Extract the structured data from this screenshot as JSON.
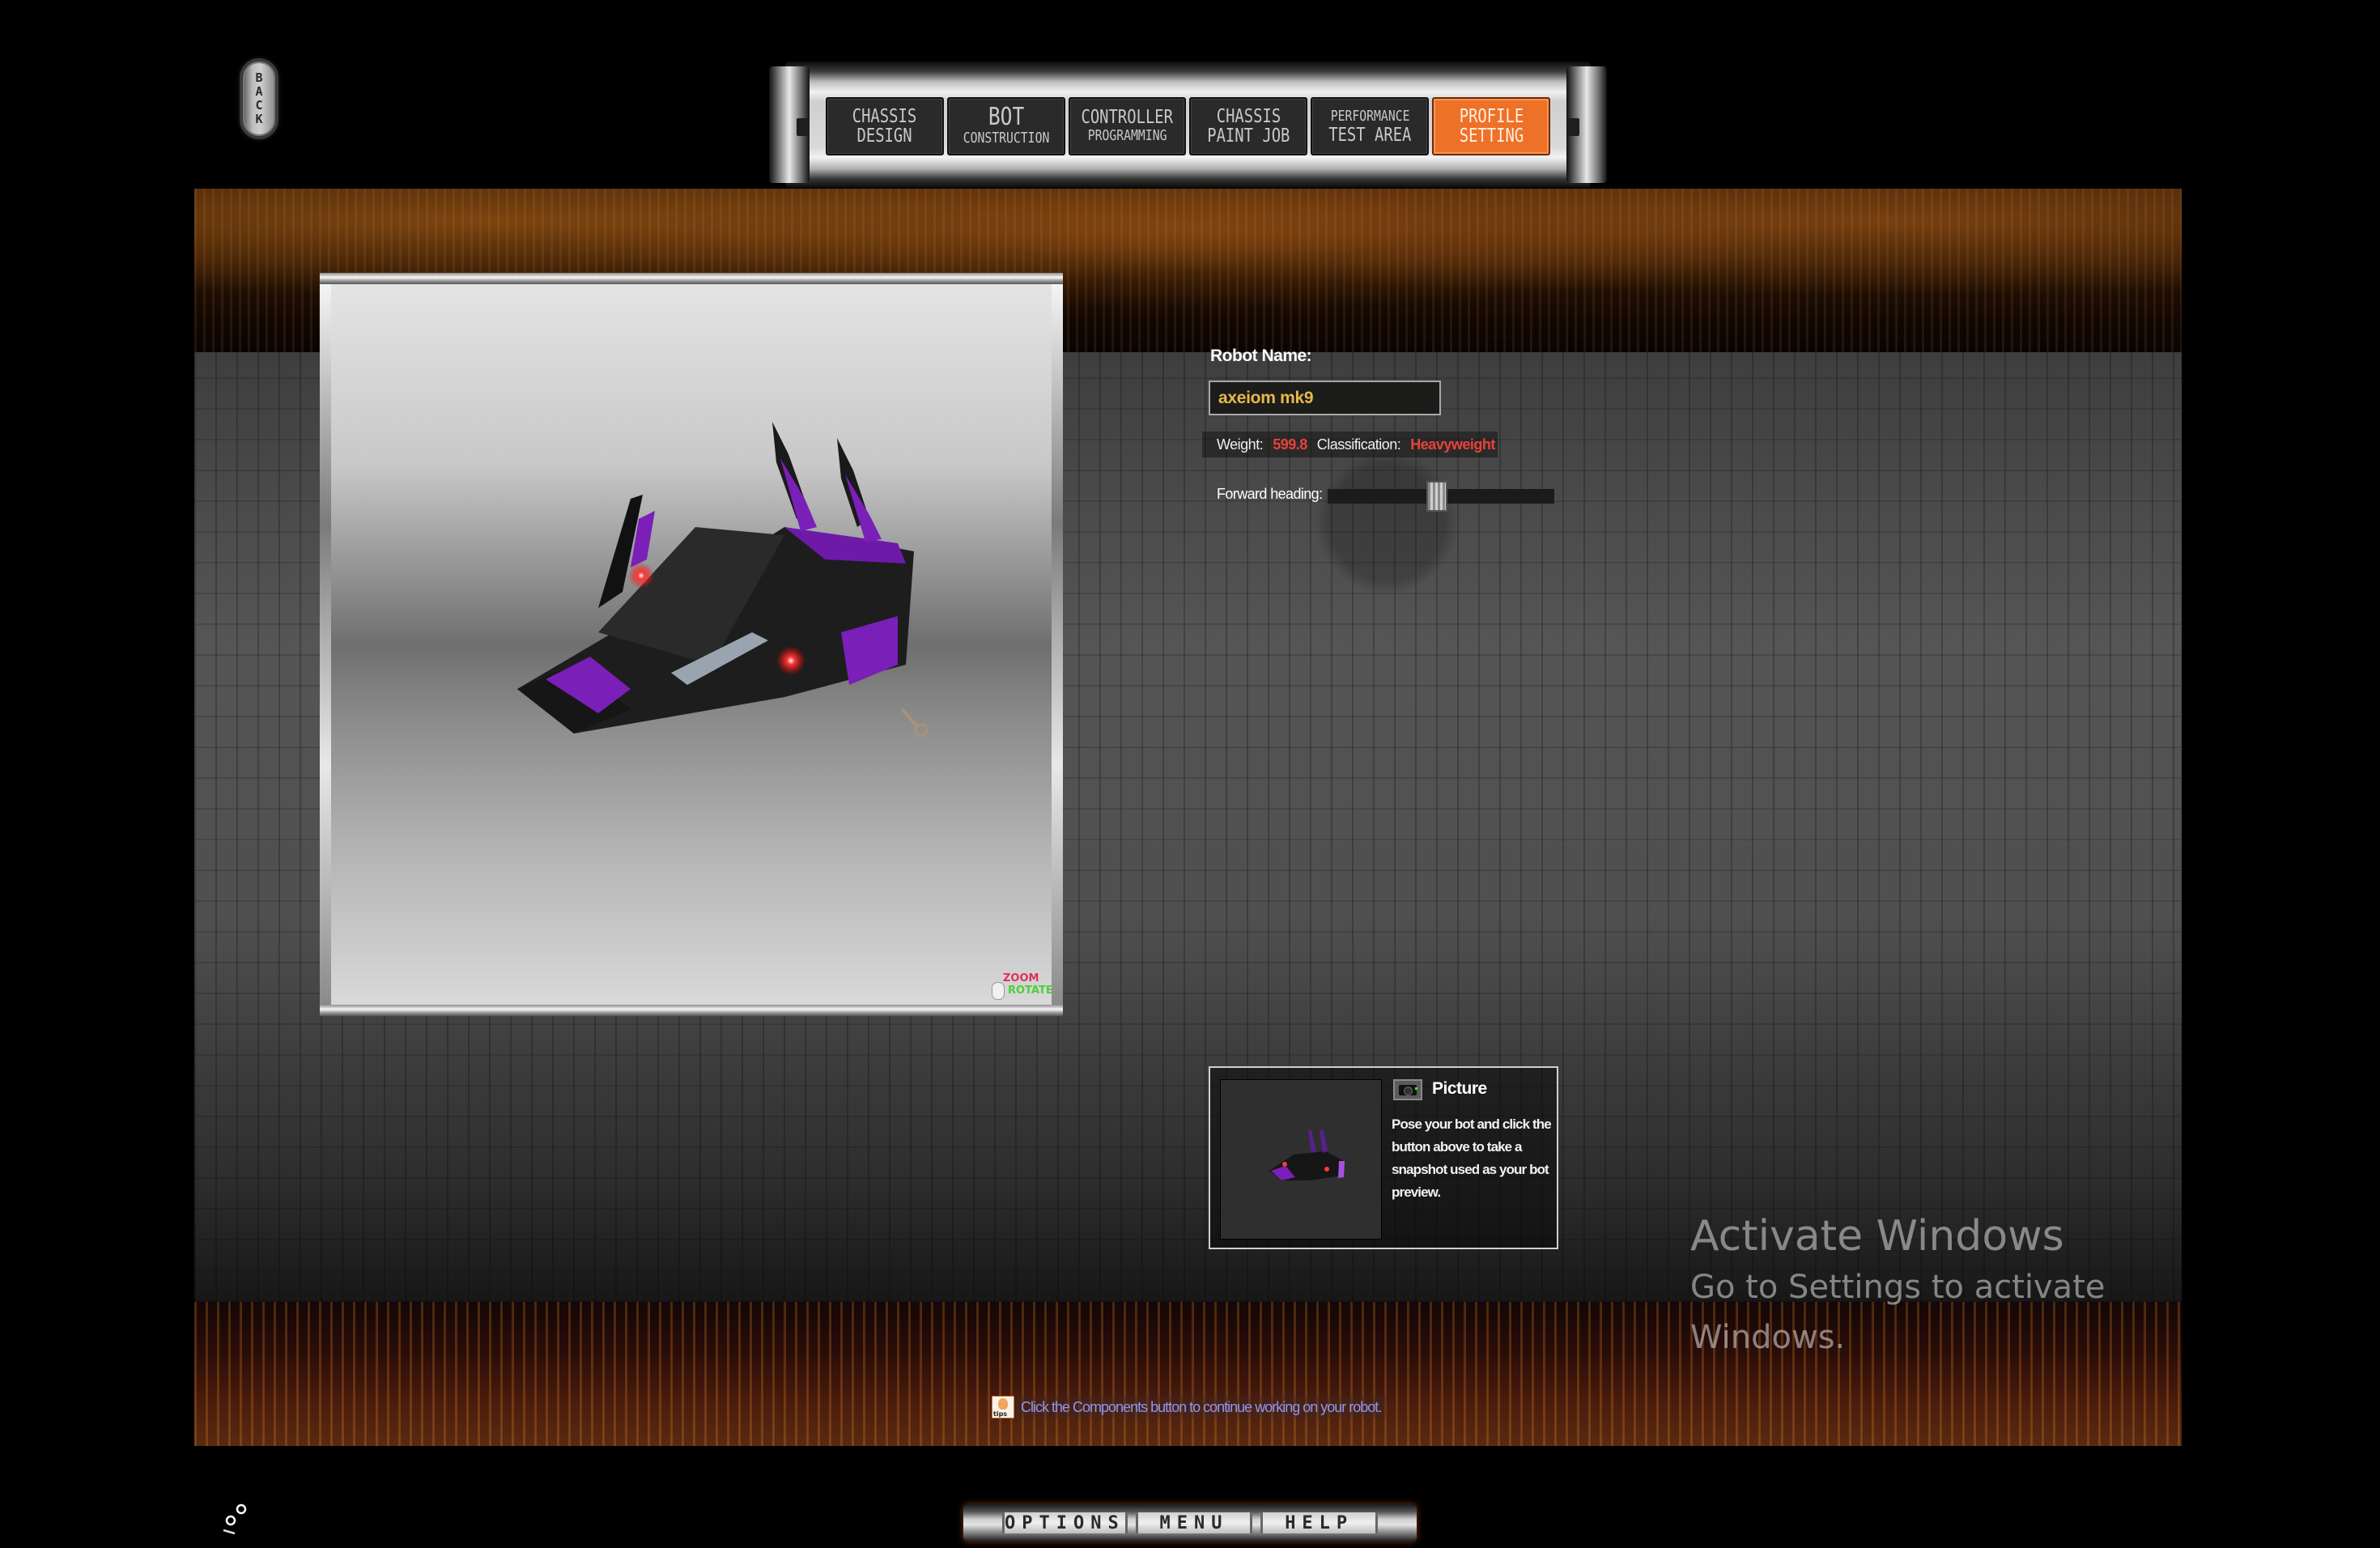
{
  "back_button": {
    "label": "BACK"
  },
  "nav": {
    "tabs": [
      {
        "line1": "CHASSIS",
        "line2": "DESIGN",
        "active": false
      },
      {
        "line1": "BOT",
        "line2": "CONSTRUCTION",
        "active": false
      },
      {
        "line1": "CONTROLLER",
        "line2": "PROGRAMMING",
        "active": false
      },
      {
        "line1": "CHASSIS",
        "line2": "PAINT JOB",
        "active": false
      },
      {
        "line1": "PERFORMANCE",
        "line2": "TEST AREA",
        "active": false
      },
      {
        "line1": "PROFILE",
        "line2": "SETTING",
        "active": true
      }
    ],
    "active_color": "#ee7128"
  },
  "viewer": {
    "zoom_hint": "ZOOM",
    "rotate_hint": "ROTATE",
    "robot_colors": {
      "body": "#1e1e1e",
      "accent": "#7a1fb8",
      "lights": "#ff3030"
    }
  },
  "profile": {
    "robot_name_label": "Robot Name:",
    "robot_name_value": "axeiom mk9",
    "weight_label": "Weight:",
    "weight_value": "599.8",
    "classification_label": "Classification:",
    "classification_value": "Heavyweight",
    "forward_heading_label": "Forward heading:",
    "forward_heading_fraction": 0.48
  },
  "picture": {
    "title": "Picture",
    "description": "Pose your bot and click the button above to take a snapshot used as your bot preview.",
    "camera_icon": "camera-icon"
  },
  "tip": {
    "icon_label": "tips",
    "text": "Click the Components button to continue working on your robot."
  },
  "watermark": {
    "heading": "Activate Windows",
    "subtext": "Go to Settings to activate Windows."
  },
  "bottom_bar": {
    "options_label": "OPTIONS",
    "menu_label": "MENU",
    "help_label": "HELP"
  }
}
